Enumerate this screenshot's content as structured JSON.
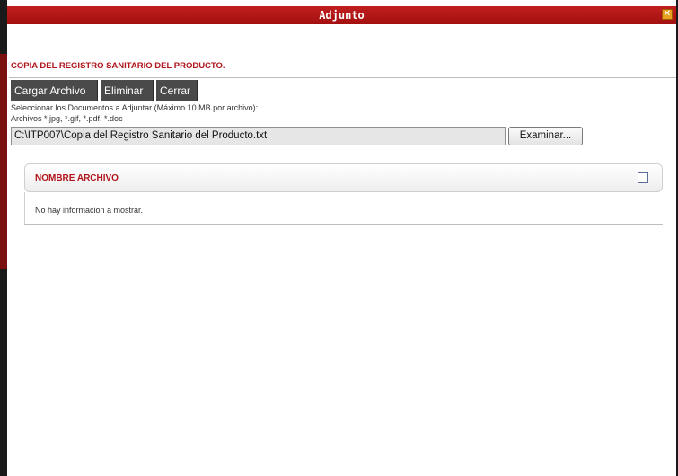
{
  "window": {
    "title": "Adjunto",
    "close_icon": "close-icon",
    "accent_color": "#b0141c"
  },
  "section": {
    "title": "COPIA DEL REGISTRO SANITARIO DEL PRODUCTO."
  },
  "toolbar": {
    "upload_label": "Cargar Archivo",
    "delete_label": "Eliminar",
    "close_label": "Cerrar"
  },
  "help": {
    "line1": "Seleccionar los Documentos a Adjuntar (Máximo 10 MB por archivo):",
    "line2": "Archivos *.jpg, *.gif, *.pdf, *.doc"
  },
  "file_input": {
    "value": "C:\\ITP007\\Copia del Registro Sanitario del Producto.txt",
    "browse_label": "Examinar..."
  },
  "grid": {
    "column_header": "NOMBRE ARCHIVO",
    "empty_message": "No hay informacion a mostrar.",
    "select_all_checked": false
  }
}
